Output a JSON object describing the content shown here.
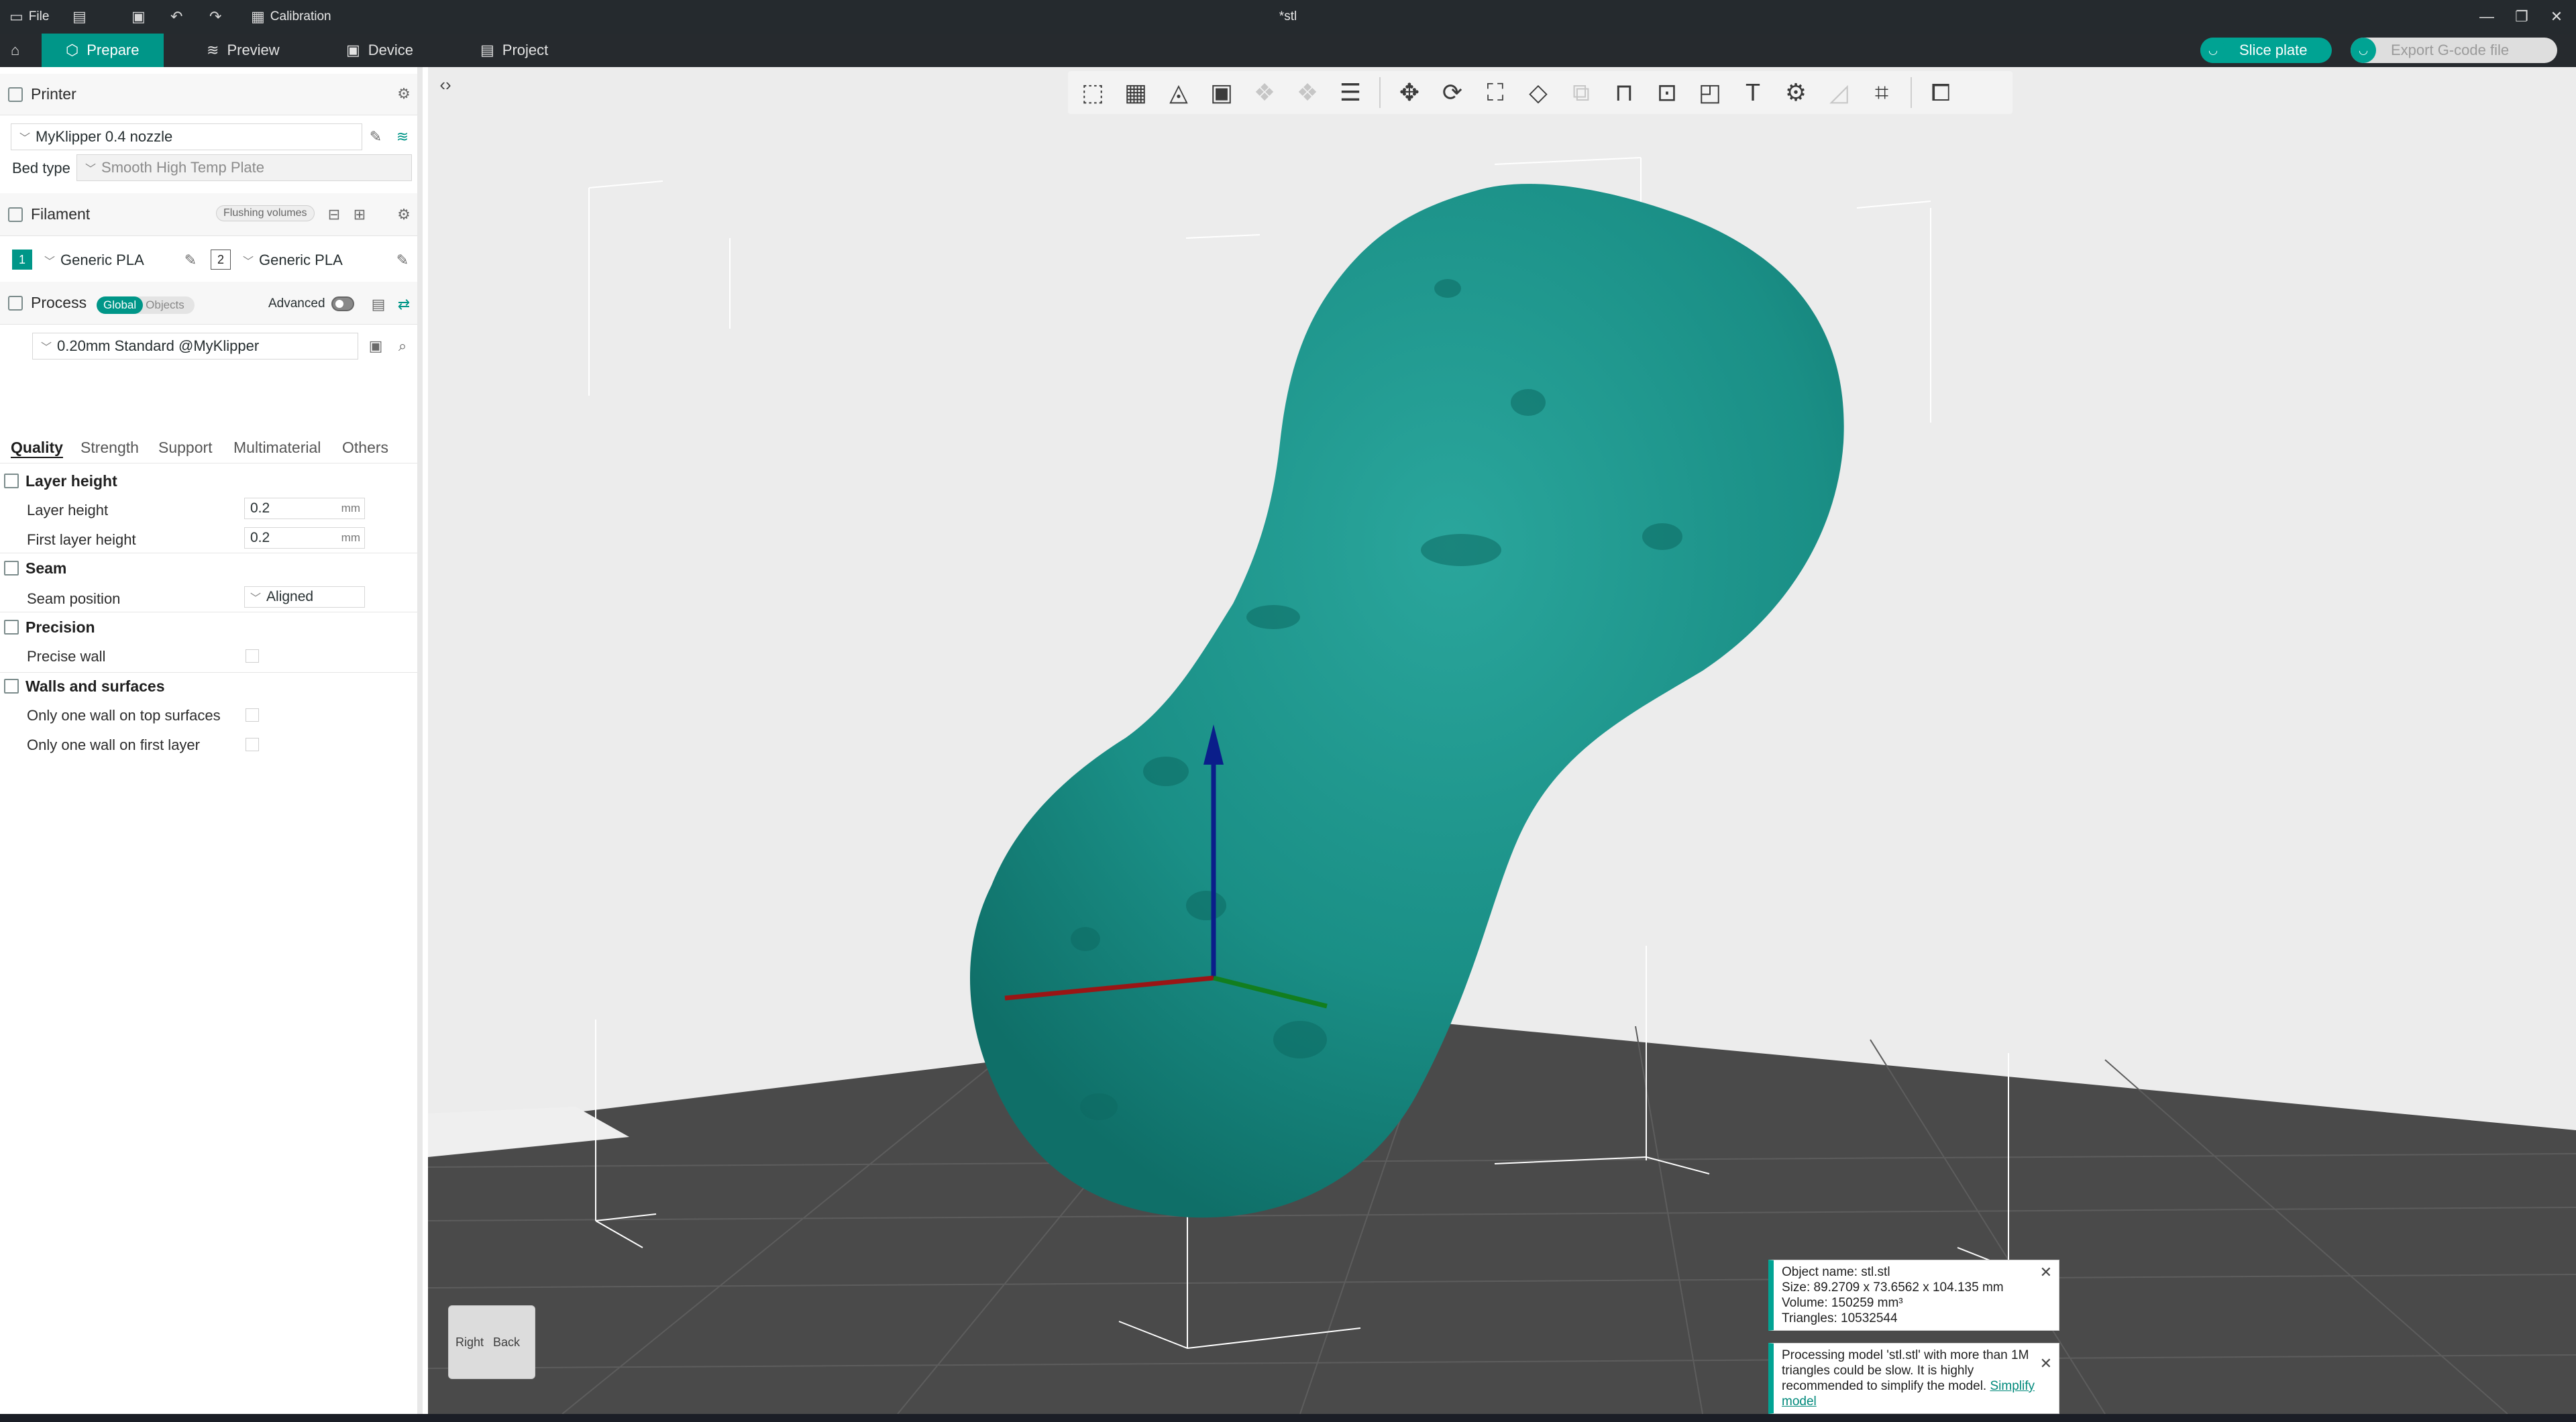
{
  "titlebar": {
    "file_label": "File",
    "calibration_label": "Calibration",
    "doc_title": "*stl"
  },
  "nav": {
    "tabs": [
      {
        "label": "Prepare",
        "icon": "cube-icon"
      },
      {
        "label": "Preview",
        "icon": "layers-icon"
      },
      {
        "label": "Device",
        "icon": "device-icon"
      },
      {
        "label": "Project",
        "icon": "project-icon"
      }
    ],
    "slice_label": "Slice plate",
    "export_label": "Export G-code file"
  },
  "printer": {
    "section_title": "Printer",
    "name": "MyKlipper 0.4 nozzle",
    "bed_label": "Bed type",
    "bed_value": "Smooth High Temp Plate"
  },
  "filament": {
    "section_title": "Filament",
    "flushing_label": "Flushing volumes",
    "slots": [
      {
        "index": "1",
        "name": "Generic PLA",
        "color": "#009688"
      },
      {
        "index": "2",
        "name": "Generic PLA",
        "color": "#ffffff"
      }
    ]
  },
  "process": {
    "section_title": "Process",
    "global_label": "Global",
    "objects_label": "Objects",
    "advanced_label": "Advanced",
    "preset": "0.20mm Standard @MyKlipper"
  },
  "tabs": [
    "Quality",
    "Strength",
    "Support",
    "Multimaterial",
    "Others"
  ],
  "quality": {
    "layer_height_group": "Layer height",
    "layer_height_label": "Layer height",
    "layer_height_value": "0.2",
    "first_layer_label": "First layer height",
    "first_layer_value": "0.2",
    "unit": "mm",
    "seam_group": "Seam",
    "seam_position_label": "Seam position",
    "seam_position_value": "Aligned",
    "precision_group": "Precision",
    "precise_wall_label": "Precise wall",
    "walls_group": "Walls and surfaces",
    "one_wall_top_label": "Only one wall on top surfaces",
    "one_wall_first_label": "Only one wall on first layer"
  },
  "viewport": {
    "cube_right": "Right",
    "cube_back": "Back",
    "model_color": "#1a8f86"
  },
  "notifications": {
    "object_info": {
      "name": "Object name: stl.stl",
      "size": "Size: 89.2709 x 73.6562 x 104.135 mm",
      "volume": "Volume: 150259 mm³",
      "triangles": "Triangles: 10532544"
    },
    "warning_text": "Processing model 'stl.stl' with more than 1M triangles could be slow. It is highly recommended to simplify the model.",
    "simplify_link": "Simplify model"
  }
}
